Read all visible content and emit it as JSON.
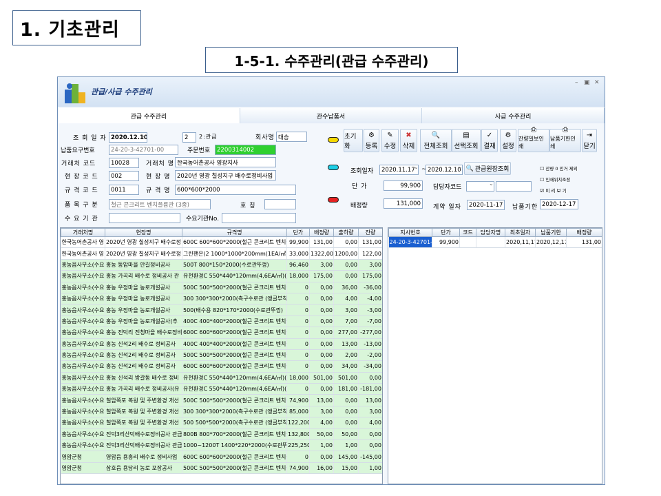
{
  "slide": {
    "title": "1. 기초관리",
    "subtitle": "1-5-1. 수주관리(관급 수주관리)"
  },
  "window": {
    "title": "관급/사급 수주관리"
  },
  "tabs": [
    "관급 수주관리",
    "관수납품서",
    "사급 수주관리"
  ],
  "form": {
    "date_label": "조 회 일 자",
    "date": "2020.12.10",
    "type_code": "2",
    "type_label": "2:관급",
    "company_label": "회사명",
    "company": "대승",
    "req_no_label": "납품요구번호",
    "req_no": "24-20-3-42701-00",
    "order_no_label": "주문번호",
    "order_no": "2200314002",
    "client_code_label": "거래처 코드",
    "client_code": "10028",
    "client_name_label": "거래처 명",
    "client_name": "한국농어촌공사 영광지사",
    "site_code_label": "현 장 코 드",
    "site_code": "002",
    "site_name_label": "현 장 명",
    "site_name": "2020년 영광 칠성지구 배수로정비사업",
    "spec_code_label": "규 격 코 드",
    "spec_code": "0011",
    "spec_name_label": "규 격 명",
    "spec_name": "600*600*2000",
    "item_cat_label": "품 목 구 분",
    "item_cat": "철근 콘크리트 벤치플륨관 (3종)",
    "title_label": "호 칭",
    "demand_label": "수 요 기 관",
    "demand_no_label": "수요기관No."
  },
  "toolbar": [
    "초기화",
    "등록",
    "수정",
    "삭제",
    "전체조회",
    "선택조회",
    "결재",
    "설정",
    "잔량일보인쇄",
    "납품기한인쇄",
    "닫기"
  ],
  "toolbar_icons": [
    "none",
    "register-icon",
    "edit-icon",
    "delete-icon",
    "search-all-icon",
    "search-select-icon",
    "approve-icon",
    "settings-icon",
    "print-icon",
    "print-icon",
    "exit-icon"
  ],
  "query": {
    "date_label": "조회일자",
    "from": "2020.11.17",
    "to": "2020.12.10",
    "btn": "관급원장조회",
    "price_label": "단 가",
    "price": "99,900",
    "manager_code_label": "담당자코드",
    "alloc_label": "배정량",
    "alloc": "131,000",
    "contract_label": "계약 일자",
    "contract": "2020-11-17",
    "due_label": "납품기한",
    "due": "2020-12-17",
    "checks": [
      "잔량 0 인거 제외",
      "인쇄위치조정",
      "미 리 보 기"
    ]
  },
  "left_grid": {
    "headers": [
      "거래처명",
      "현장명",
      "규격명",
      "단가",
      "배정량",
      "출하량",
      "잔량"
    ],
    "rows": [
      [
        "한국농어촌공사 영",
        "2020년 영광 칠성지구 배수로정",
        "600C 600*600*2000(철근 콘크리트 벤치플륨",
        "99,900",
        "131,00",
        "0,00",
        "131,00"
      ],
      [
        "한국농어촌공사 영",
        "2020년 영광 칠성지구 배수로정",
        "그린팬은(2 1000*1000*200mm(1EA/㎡)(그린",
        "33,000",
        "1322,00",
        "1200,00",
        "122,00"
      ],
      [
        "홍농읍사무소(수요",
        "홍농 동암마을 안길정비공사",
        "500T 800*150*2000(수로관뚜껑)",
        "96,460",
        "3,00",
        "0,00",
        "3,00"
      ],
      [
        "홍농읍사무소(수요",
        "홍농 가곡리 배수로 정비공사 관",
        "유천환경C 550*440*120mm(4,6EA/㎡)(유천",
        "18,000",
        "175,00",
        "0,00",
        "175,00"
      ],
      [
        "홍농읍사무소(수요",
        "홍농 우정마을 농로개설공사",
        "500C 500*500*2000(철근 콘크리트 벤치플륨",
        "0",
        "0,00",
        "36,00",
        "-36,00"
      ],
      [
        "홍농읍사무소(수요",
        "홍농 우정마을 농로개설공사",
        "300 300*300*2000(측구수로관 (앵글부착형)",
        "0",
        "0,00",
        "4,00",
        "-4,00"
      ],
      [
        "홍농읍사무소(수요",
        "홍농 우정마을 농로개설공사",
        "500(배수용 820*170*2000(수로관뚜껑)",
        "0",
        "0,00",
        "3,00",
        "-3,00"
      ],
      [
        "홍농읍사무소(수요",
        "홍농 우정마을 농로개설공사(추",
        "400C 400*400*2000(철근 콘크리트 벤치플륨",
        "0",
        "0,00",
        "7,00",
        "-7,00"
      ],
      [
        "홍농읍사무소(수요",
        "홍농 진덕리 진청마을 배수로정비",
        "600C 600*600*2000(철근 콘크리트 벤치플륨",
        "0",
        "0,00",
        "277,00",
        "-277,00"
      ],
      [
        "홍농읍사무소(수요",
        "홍농 신석2리 배수로 정비공사",
        "400C 400*400*2000(철근 콘크리트 벤치플륨",
        "0",
        "0,00",
        "13,00",
        "-13,00"
      ],
      [
        "홍농읍사무소(수요",
        "홍농 신석2리 배수로 정비공사",
        "500C 500*500*2000(철근 콘크리트 벤치플륨",
        "0",
        "0,00",
        "2,00",
        "-2,00"
      ],
      [
        "홍농읍사무소(수요",
        "홍농 신석2리 배수로 정비공사",
        "600C 600*600*2000(철근 콘크리트 벤치플륨",
        "0",
        "0,00",
        "34,00",
        "-34,00"
      ],
      [
        "홍농읍사무소(수요",
        "홍농 신석리 방갈동 배수로 정비",
        "유천환경C 550*440*120mm(4,6EA/㎡)(유천",
        "18,000",
        "501,00",
        "501,00",
        "0,00"
      ],
      [
        "홍농읍사무소(수요",
        "홍농 가곡리 배수로 정비공사(유",
        "유천환경C 550*440*120mm(4,6EA/㎡)(유천",
        "0",
        "0,00",
        "181,00",
        "-181,00"
      ],
      [
        "홍농읍사무소(수요",
        "칠암쪽포 복원 및 주변환경 개선",
        "500C 500*500*2000(철근 콘크리트 벤치플륨",
        "74,900",
        "13,00",
        "0,00",
        "13,00"
      ],
      [
        "홍농읍사무소(수요",
        "칠암쪽포 복원 및 주변환경 개선",
        "300 300*300*2000(측구수로관 (앵글부착형)",
        "85,000",
        "3,00",
        "0,00",
        "3,00"
      ],
      [
        "홍농읍사무소(수요",
        "칠암쪽포 복원 및 주변환경 개선",
        "500 500*500*2000(측구수로관 (앵글부착형)",
        "122,200",
        "4,00",
        "0,00",
        "4,00"
      ],
      [
        "홍농읍사무소(수요",
        "진덕3리산덕배수로정비공사 관급",
        "800B 800*700*2000(철근 콘크리트 벤치플륨",
        "132,800",
        "50,00",
        "50,00",
        "0,00"
      ],
      [
        "홍농읍사무소(수요",
        "진덕3리산덕배수로정비공사 관급",
        "1000~1200T 1400*220*2000(수로관뚜껑)",
        "225,250",
        "1,00",
        "1,00",
        "0,00"
      ],
      [
        "영암군청",
        "영암읍 용흥리 배수로 정비사업",
        "600C 600*600*2000(철근 콘크리트 벤치플륨",
        "0",
        "0,00",
        "145,00",
        "-145,00"
      ],
      [
        "영암군청",
        "삼호읍 용당리 농로 포장공사",
        "500C 500*500*2000(철근 콘크리트 벤치플륨",
        "74,900",
        "16,00",
        "15,00",
        "1,00"
      ]
    ]
  },
  "right_grid": {
    "headers": [
      "지시번호",
      "단가",
      "코드",
      "담당자명",
      "최초일자",
      "납품기한",
      "배정량"
    ],
    "rows": [
      [
        "24-20-3-42701-",
        "99,900",
        "",
        "",
        "2020,11,17",
        "2020,12,17",
        "131,00"
      ]
    ]
  }
}
